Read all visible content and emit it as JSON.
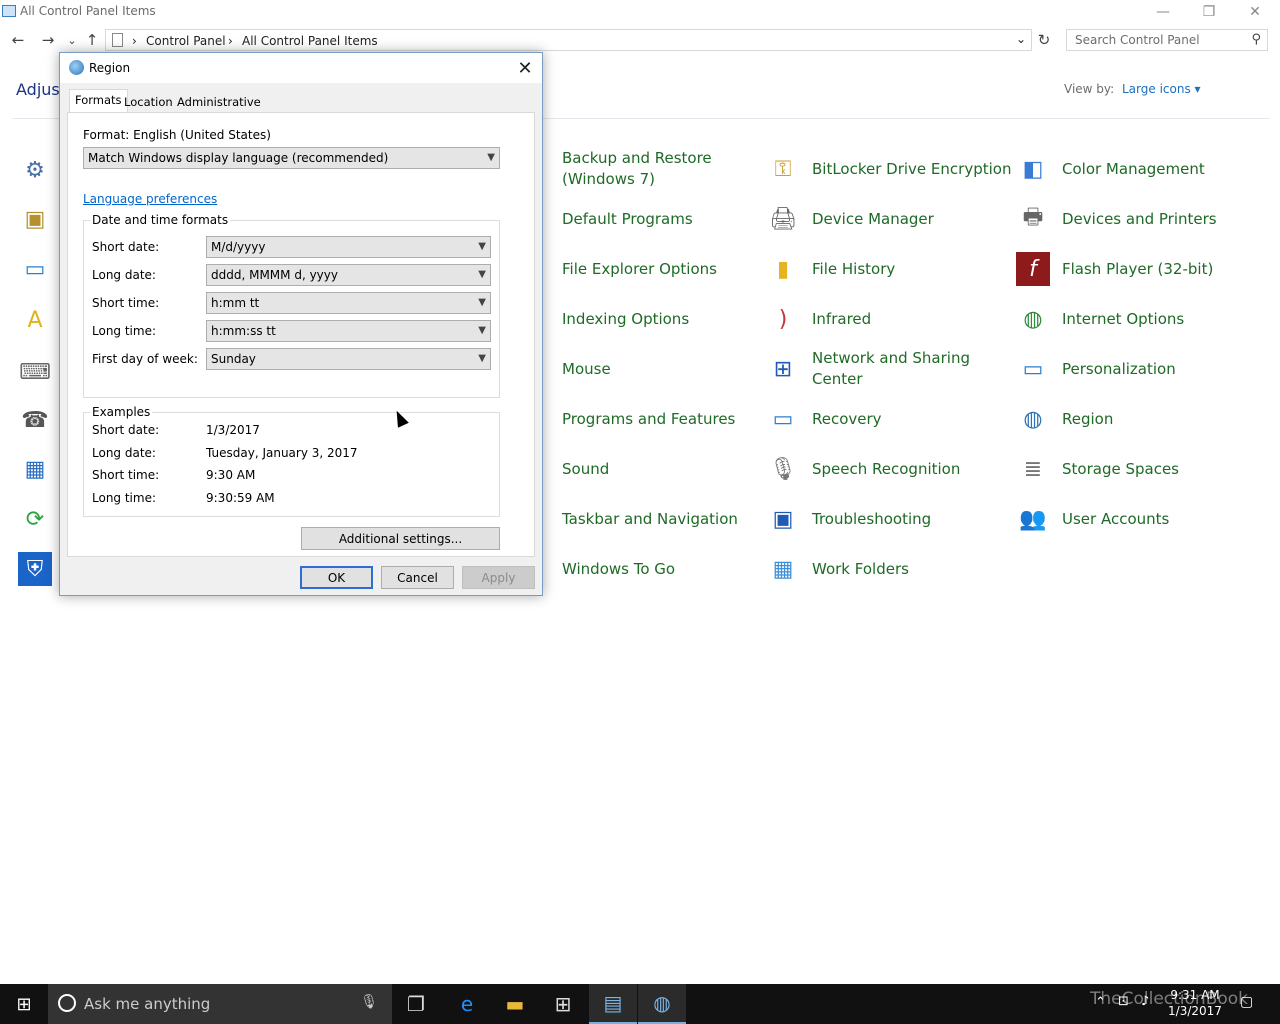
{
  "window": {
    "title": "All Control Panel Items",
    "min": "—",
    "restore": "❐",
    "close": "✕"
  },
  "nav": {
    "back": "←",
    "forward": "→",
    "recent": "⌄",
    "up": "↑",
    "dropdown": "⌄",
    "refresh": "↻"
  },
  "breadcrumb": {
    "sep1": "›",
    "item1": "Control Panel",
    "sep2": "›",
    "item2": "All Control Panel Items"
  },
  "search": {
    "placeholder": "Search Control Panel",
    "icon": "search-icon"
  },
  "header": {
    "title_partial": "Adjust",
    "viewby_label": "View by:",
    "viewby_value": "Large icons ▾"
  },
  "items": {
    "col1": [
      "Backup and Restore (Windows 7)",
      "Default Programs",
      "File Explorer Options",
      "Indexing Options",
      "Mouse",
      "Programs and Features",
      "Sound",
      "Taskbar and Navigation",
      "Windows To Go"
    ],
    "col2": [
      "BitLocker Drive Encryption",
      "Device Manager",
      "File History",
      "Infrared",
      "Network and Sharing Center",
      "Recovery",
      "Speech Recognition",
      "Troubleshooting",
      "Work Folders"
    ],
    "col3": [
      "Color Management",
      "Devices and Printers",
      "Flash Player (32-bit)",
      "Internet Options",
      "Personalization",
      "Region",
      "Storage Spaces",
      "User Accounts"
    ]
  },
  "dialog": {
    "title": "Region",
    "close": "✕",
    "tabs": [
      "Formats",
      "Location",
      "Administrative"
    ],
    "format_label": "Format: English (United States)",
    "format_value": "Match Windows display language (recommended)",
    "language_link": "Language preferences",
    "datetime_group": "Date and time formats",
    "fields": [
      {
        "label": "Short date:",
        "value": "M/d/yyyy"
      },
      {
        "label": "Long date:",
        "value": "dddd, MMMM d, yyyy"
      },
      {
        "label": "Short time:",
        "value": "h:mm tt"
      },
      {
        "label": "Long time:",
        "value": "h:mm:ss tt"
      },
      {
        "label": "First day of week:",
        "value": "Sunday"
      }
    ],
    "examples_group": "Examples",
    "examples": [
      {
        "label": "Short date:",
        "value": "1/3/2017"
      },
      {
        "label": "Long date:",
        "value": "Tuesday, January 3, 2017"
      },
      {
        "label": "Short time:",
        "value": "9:30 AM"
      },
      {
        "label": "Long time:",
        "value": "9:30:59 AM"
      }
    ],
    "additional_button": "Additional settings...",
    "ok": "OK",
    "cancel": "Cancel",
    "apply": "Apply"
  },
  "taskbar": {
    "cortana": "Ask me anything",
    "time": "9:31 AM",
    "date": "1/3/2017",
    "watermark": "TheCollectionBook"
  },
  "colors": {
    "link_green": "#1f6a26",
    "accent_blue": "#1e6fbf",
    "taskbar": "#111111"
  }
}
